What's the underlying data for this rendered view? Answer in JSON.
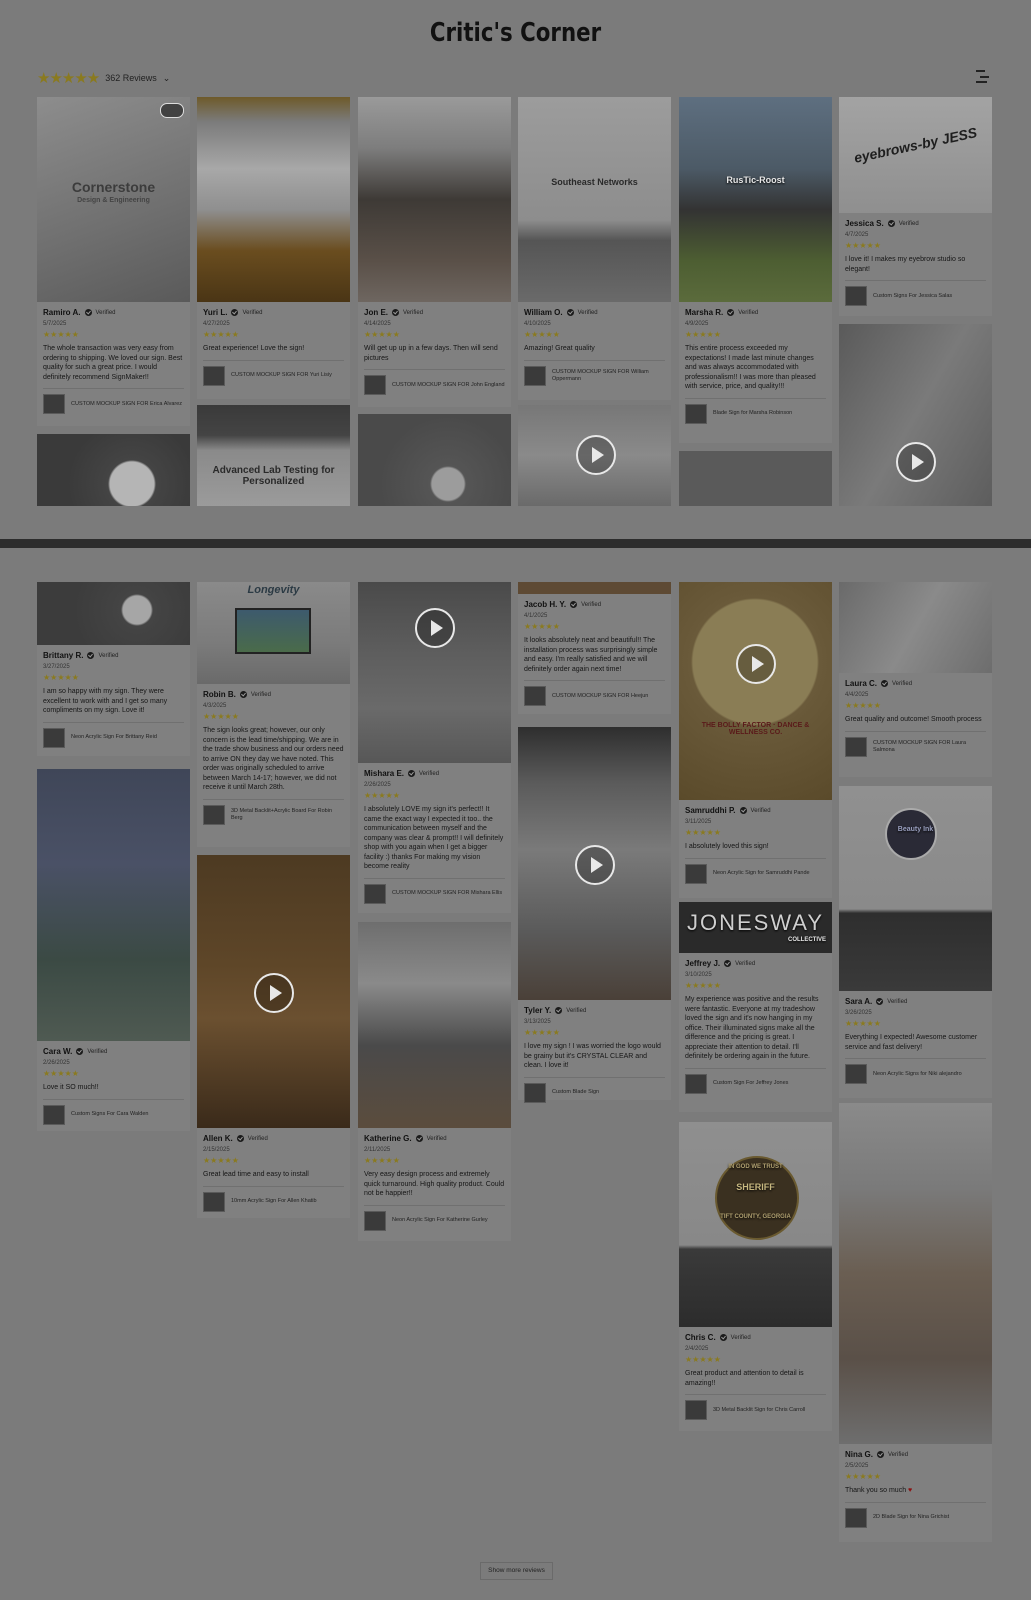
{
  "page": {
    "title": "Critic's Corner"
  },
  "summary": {
    "reviews_label": "362 Reviews",
    "stars": "★★★★★",
    "star_color": "#8a7a1f"
  },
  "load_more": {
    "label": "Show more reviews"
  },
  "photo_labels": {
    "cornerstone": "Cornerstone",
    "cornerstone_sub": "Design & Engineering",
    "southeast": "Southeast Networks",
    "eyebrows": "eyebrows-by JESS",
    "rustic": "RusTic-Roost",
    "advanced": "Advanced Lab Testing for Personalized",
    "longevity": "Longevity",
    "bolly": "THE BOLLY FACTOR · DANCE & WELLNESS CO.",
    "jonesway": "JONESWAY",
    "jonesway_sub": "COLLECTIVE",
    "sheriff": "SHERIFF",
    "sheriff_top": "IN GOD WE TRUST",
    "sheriff_bottom": "TIFT COUNTY, GEORGIA",
    "beauty": "Beauty Ink"
  },
  "reviews": {
    "ramiro": {
      "author": "Ramiro A.",
      "verified": "Verified",
      "date": "5/7/2025",
      "stars": "★★★★★",
      "text": "The whole transaction was very easy from ordering to shipping. We loved our sign. Best quality for such a great price. I would definitely recommend SignMaker!!",
      "product": "CUSTOM MOCKUP SIGN FOR Erica Alvarez"
    },
    "yuri": {
      "author": "Yuri L.",
      "verified": "Verified",
      "date": "4/27/2025",
      "stars": "★★★★★",
      "text": "Great experience! Love the sign!",
      "product": "CUSTOM MOCKUP SIGN FOR Yuri Lisiy"
    },
    "jon": {
      "author": "Jon E.",
      "verified": "Verified",
      "date": "4/14/2025",
      "stars": "★★★★★",
      "text": "Will get up up in a few days. Then will send pictures",
      "product": "CUSTOM MOCKUP SIGN FOR John England"
    },
    "william": {
      "author": "William O.",
      "verified": "Verified",
      "date": "4/10/2025",
      "stars": "★★★★★",
      "text": "Amazing! Great quality",
      "product": "CUSTOM MOCKUP SIGN FOR William Oppermann"
    },
    "marsha": {
      "author": "Marsha R.",
      "verified": "Verified",
      "date": "4/9/2025",
      "stars": "★★★★★",
      "text": "This entire process exceeded my expectations! I made last minute changes and was always accommodated with professionalism!! I was more than pleased with service, price, and quality!!!",
      "product": "Blade Sign for Marsha Robinson"
    },
    "jessica": {
      "author": "Jessica S.",
      "verified": "Verified",
      "date": "4/7/2025",
      "stars": "★★★★★",
      "text": "I love it! I makes my eyebrow studio so elegant!",
      "product": "Custom Signs For Jessica Salas"
    },
    "brittany": {
      "author": "Brittany R.",
      "verified": "Verified",
      "date": "3/27/2025",
      "stars": "★★★★★",
      "text": "I am so happy with my sign. They were excellent to work with and I get so many compliments on my sign. Love it!",
      "product": "Neon Acrylic Sign For Brittany Reid"
    },
    "robin": {
      "author": "Robin B.",
      "verified": "Verified",
      "date": "4/3/2025",
      "stars": "★★★★★",
      "text": "The sign looks great; however, our only concern is the lead time/shipping. We are in the trade show business and our orders need to arrive ON they day we have noted. This order was originally scheduled to arrive between March 14-17; however, we did not receive it until March 28th.",
      "product": "3D Metal Backlit+Acrylic Board For Robin Berg"
    },
    "mishara": {
      "author": "Mishara E.",
      "verified": "Verified",
      "date": "2/26/2025",
      "stars": "★★★★★",
      "text": "I absolutely LOVE my sign it's perfect!! It came the exact way I expected it too.. the communication between myself and the company was clear & prompt!! I will definitely shop with you again when I get a bigger facility :) thanks For making my vision become reality",
      "product": "CUSTOM MOCKUP SIGN FOR Mishara Ellis"
    },
    "jacob": {
      "author": "Jacob H. Y.",
      "verified": "Verified",
      "date": "4/1/2025",
      "stars": "★★★★★",
      "text": "It looks absolutely neat and beautiful!! The installation process was surprisingly simple and easy. I'm really satisfied and we will definitely order again next time!",
      "product": "CUSTOM MOCKUP SIGN FOR Heejun"
    },
    "samruddhi": {
      "author": "Samruddhi P.",
      "verified": "Verified",
      "date": "3/11/2025",
      "stars": "★★★★★",
      "text": "I absolutely loved this sign!",
      "product": "Neon Acrylic Sign for Samruddhi Pande"
    },
    "laura": {
      "author": "Laura C.",
      "verified": "Verified",
      "date": "4/4/2025",
      "stars": "★★★★★",
      "text": "Great quality and outcome! Smooth process",
      "product": "CUSTOM MOCKUP SIGN FOR Laura Salmona"
    },
    "cara": {
      "author": "Cara W.",
      "verified": "Verified",
      "date": "2/26/2025",
      "stars": "★★★★★",
      "text": "Love it SO much!!",
      "product": "Custom Signs For Cara Walden"
    },
    "allen": {
      "author": "Allen K.",
      "verified": "Verified",
      "date": "2/15/2025",
      "stars": "★★★★★",
      "text": "Great lead time and easy to install",
      "product": "10mm Acrylic Sign For Allen Khatib"
    },
    "katherine": {
      "author": "Katherine G.",
      "verified": "Verified",
      "date": "2/11/2025",
      "stars": "★★★★★",
      "text": "Very easy design process and extremely quick turnaround. High quality product. Could not be happier!!",
      "product": "Neon Acrylic Sign For Katherine Gurley"
    },
    "tyler": {
      "author": "Tyler Y.",
      "verified": "Verified",
      "date": "3/13/2025",
      "stars": "★★★★★",
      "text": "I love my sign ! I was worried the logo would be grainy but it's CRYSTAL CLEAR and clean. I love it!",
      "product": "Custom Blade Sign"
    },
    "jeffrey": {
      "author": "Jeffrey J.",
      "verified": "Verified",
      "date": "3/10/2025",
      "stars": "★★★★★",
      "text": "My experience was positive and the results were fantastic. Everyone at my tradeshow loved the sign and it's now hanging in my office. Their illuminated signs make all the difference and the pricing is great. I appreciate their attention to detail. I'll definitely be ordering again in the future.",
      "product": "Custom Sign For Jeffrey Jones"
    },
    "sara": {
      "author": "Sara A.",
      "verified": "Verified",
      "date": "3/26/2025",
      "stars": "★★★★★",
      "text": "Everything I expected! Awesome customer service and fast delivery!",
      "product": "Neon Acrylic Signs for Niki alejandro"
    },
    "chris": {
      "author": "Chris C.",
      "verified": "Verified",
      "date": "2/4/2025",
      "stars": "★★★★★",
      "text": "Great product and attention to detail is amazing!!",
      "product": "3D Metal Backlit Sign for Chris Carroll"
    },
    "nina": {
      "author": "Nina G.",
      "verified": "Verified",
      "date": "2/5/2025",
      "stars": "★★★★★",
      "text": "Thank you so much",
      "heart": "♥",
      "product": "2D Blade Sign for Nina Grichist"
    }
  }
}
